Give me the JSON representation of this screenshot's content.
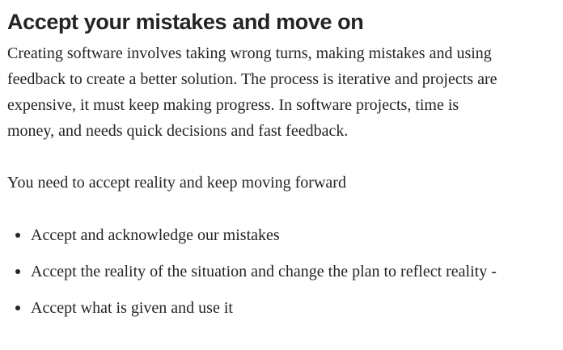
{
  "article": {
    "heading": "Accept your mistakes and move on",
    "paragraph_1_lines": [
      "Creating software involves taking wrong turns, making mistakes and using",
      "feedback to create a better solution. The process is iterative and projects are",
      "expensive, it must keep making progress. In software projects, time is",
      "money, and needs quick decisions and fast feedback."
    ],
    "paragraph_2": "You need to accept reality and keep moving forward",
    "bullets": [
      "Accept and acknowledge our mistakes",
      "Accept the reality of the situation and change the plan to reflect reality -",
      "Accept what is given and use it"
    ]
  }
}
